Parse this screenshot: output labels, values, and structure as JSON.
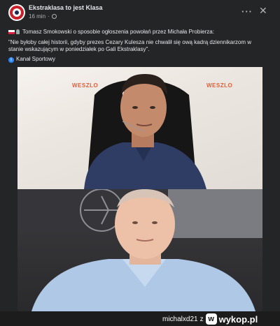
{
  "post": {
    "page_name": "Ekstraklasa to jest Klasa",
    "time": "16 min",
    "text_line1": "Tomasz Smokowski o sposobie ogłoszenia powołań przez Michała Probierza:",
    "quote_line1": "\"Nie byłoby całej historii, gdyby prezes Cezary Kulesza nie chwalił się ową kadrą dziennikarzom w",
    "quote_line2": "stanie wskazującym w poniedziałek po Gali Ekstraklasy\".",
    "source": "Kanał Sportowy"
  },
  "photo": {
    "brand_left": "WESZLO",
    "brand_right": "WESZLO"
  },
  "watermark": {
    "user": "michalxd21",
    "sep": "z",
    "logo_letter": "w",
    "site": "wykop.pl"
  },
  "icons": [
    "avatar-logo",
    "globe-icon",
    "more-options-icon",
    "close-icon",
    "poland-flag-icon",
    "microphone-icon",
    "info-icon",
    "wykop-logo-icon"
  ]
}
